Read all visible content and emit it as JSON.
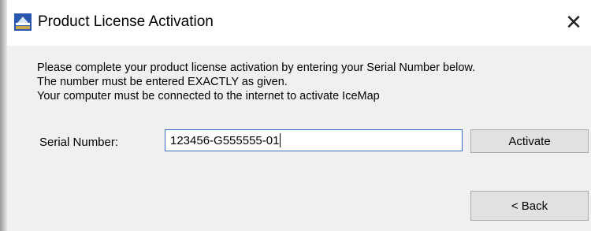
{
  "window": {
    "title": "Product License Activation"
  },
  "icons": {
    "app": "app-logo-icon",
    "close": "close-icon"
  },
  "message": {
    "line1": "Please complete your product license activation by entering your Serial Number below.",
    "line2": "The number must be entered EXACTLY as given.",
    "line3": "Your computer must be connected to the internet to activate IceMap"
  },
  "serial": {
    "label": "Serial Number:",
    "value": "123456-G555555-01"
  },
  "buttons": {
    "activate": "Activate",
    "back": "< Back"
  },
  "colors": {
    "input_border": "#3a6fc4",
    "button_face": "#e1e1e1",
    "dialog_bg": "#f0f0f0"
  }
}
